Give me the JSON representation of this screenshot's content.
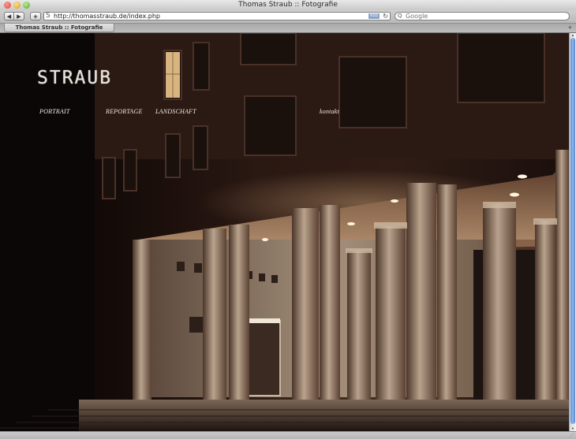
{
  "window": {
    "title": "Thomas Straub :: Fotografie"
  },
  "toolbar": {
    "back_icon": "◀",
    "forward_icon": "▶",
    "add_icon": "+",
    "url": "http://thomasstraub.de/index.php",
    "favicon": "S",
    "rss_label": "RSS",
    "reload_icon": "↻"
  },
  "search": {
    "placeholder": "Google",
    "icon": "Q"
  },
  "tabs": [
    {
      "label": "Thomas Straub :: Fotografie"
    }
  ],
  "newtab_icon": "+",
  "site": {
    "logo": "STRAUB",
    "nav": {
      "portrait": "PORTRAIT",
      "reportage": "REPORTAGE",
      "landschaft": "LANDSCHAFT",
      "kontakt": "kontakt"
    }
  },
  "colors": {
    "night": "#1a0f0c",
    "warm_light": "#d9b48a",
    "stone": "#b09b85",
    "scroll_blue": "#5b8ed6"
  }
}
